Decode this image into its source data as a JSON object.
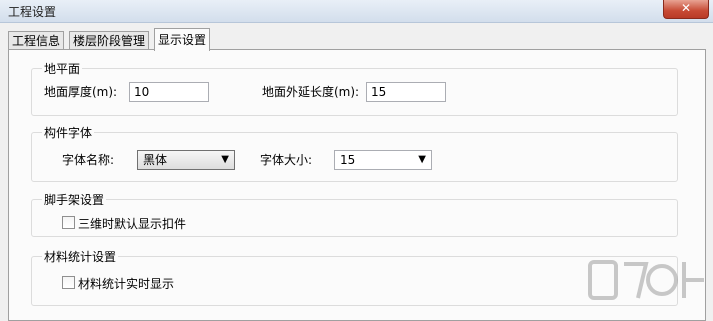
{
  "window": {
    "title": "工程设置",
    "close_glyph": "✕"
  },
  "tabs": [
    {
      "label": "工程信息",
      "active": false
    },
    {
      "label": "楼层阶段管理",
      "active": false
    },
    {
      "label": "显示设置",
      "active": true
    }
  ],
  "ground": {
    "title": "地平面",
    "thickness_label": "地面厚度(m):",
    "thickness_value": "10",
    "extension_label": "地面外延长度(m):",
    "extension_value": "15"
  },
  "font_group": {
    "title": "构件字体",
    "name_label": "字体名称:",
    "name_value": "黑体",
    "size_label": "字体大小:",
    "size_value": "15"
  },
  "scaffold": {
    "title": "脚手架设置",
    "checkbox_label": "三维时默认显示扣件",
    "checked": false
  },
  "material": {
    "title": "材料统计设置",
    "checkbox_label": "材料统计实时显示",
    "checked": false
  },
  "watermark_icon": "download-site-watermark-icon",
  "colors": {
    "close_button": "#c74a34",
    "titlebar": "#d3deec",
    "panel": "#fbfbfb"
  }
}
